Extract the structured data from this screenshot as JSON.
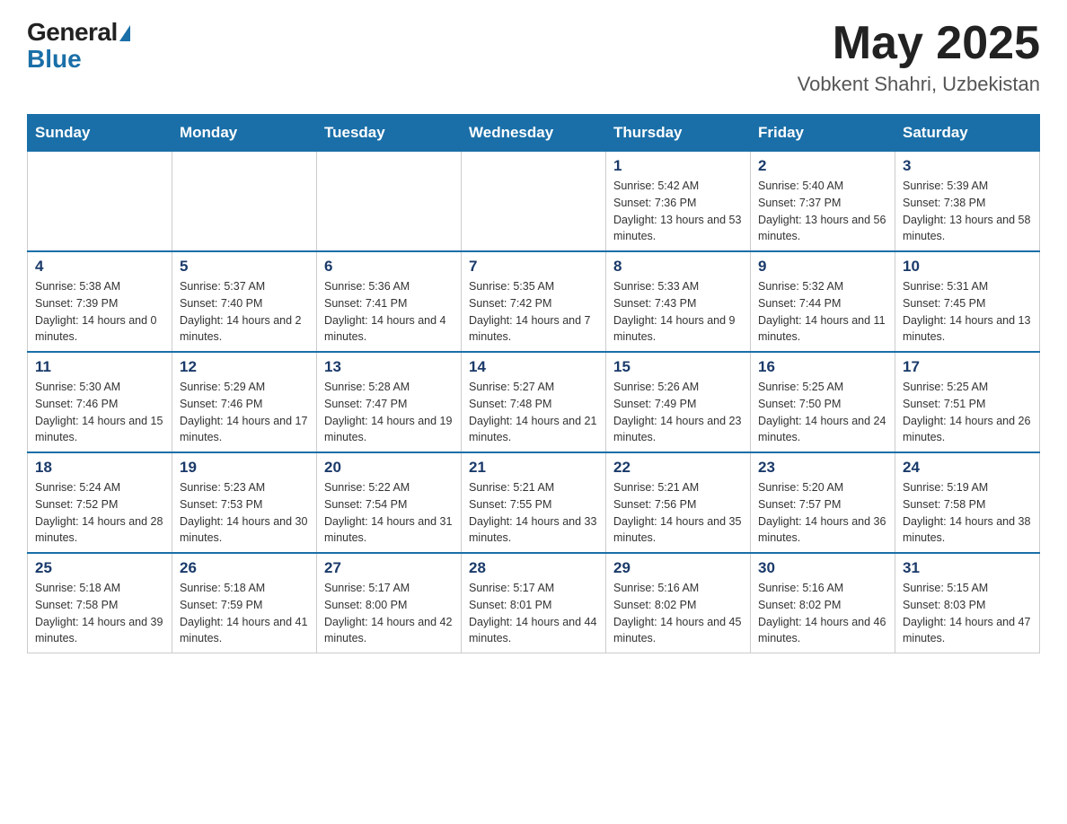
{
  "header": {
    "logo_general": "General",
    "logo_blue": "Blue",
    "month_title": "May 2025",
    "subtitle": "Vobkent Shahri, Uzbekistan"
  },
  "weekdays": [
    "Sunday",
    "Monday",
    "Tuesday",
    "Wednesday",
    "Thursday",
    "Friday",
    "Saturday"
  ],
  "weeks": [
    [
      {
        "day": "",
        "sunrise": "",
        "sunset": "",
        "daylight": ""
      },
      {
        "day": "",
        "sunrise": "",
        "sunset": "",
        "daylight": ""
      },
      {
        "day": "",
        "sunrise": "",
        "sunset": "",
        "daylight": ""
      },
      {
        "day": "",
        "sunrise": "",
        "sunset": "",
        "daylight": ""
      },
      {
        "day": "1",
        "sunrise": "Sunrise: 5:42 AM",
        "sunset": "Sunset: 7:36 PM",
        "daylight": "Daylight: 13 hours and 53 minutes."
      },
      {
        "day": "2",
        "sunrise": "Sunrise: 5:40 AM",
        "sunset": "Sunset: 7:37 PM",
        "daylight": "Daylight: 13 hours and 56 minutes."
      },
      {
        "day": "3",
        "sunrise": "Sunrise: 5:39 AM",
        "sunset": "Sunset: 7:38 PM",
        "daylight": "Daylight: 13 hours and 58 minutes."
      }
    ],
    [
      {
        "day": "4",
        "sunrise": "Sunrise: 5:38 AM",
        "sunset": "Sunset: 7:39 PM",
        "daylight": "Daylight: 14 hours and 0 minutes."
      },
      {
        "day": "5",
        "sunrise": "Sunrise: 5:37 AM",
        "sunset": "Sunset: 7:40 PM",
        "daylight": "Daylight: 14 hours and 2 minutes."
      },
      {
        "day": "6",
        "sunrise": "Sunrise: 5:36 AM",
        "sunset": "Sunset: 7:41 PM",
        "daylight": "Daylight: 14 hours and 4 minutes."
      },
      {
        "day": "7",
        "sunrise": "Sunrise: 5:35 AM",
        "sunset": "Sunset: 7:42 PM",
        "daylight": "Daylight: 14 hours and 7 minutes."
      },
      {
        "day": "8",
        "sunrise": "Sunrise: 5:33 AM",
        "sunset": "Sunset: 7:43 PM",
        "daylight": "Daylight: 14 hours and 9 minutes."
      },
      {
        "day": "9",
        "sunrise": "Sunrise: 5:32 AM",
        "sunset": "Sunset: 7:44 PM",
        "daylight": "Daylight: 14 hours and 11 minutes."
      },
      {
        "day": "10",
        "sunrise": "Sunrise: 5:31 AM",
        "sunset": "Sunset: 7:45 PM",
        "daylight": "Daylight: 14 hours and 13 minutes."
      }
    ],
    [
      {
        "day": "11",
        "sunrise": "Sunrise: 5:30 AM",
        "sunset": "Sunset: 7:46 PM",
        "daylight": "Daylight: 14 hours and 15 minutes."
      },
      {
        "day": "12",
        "sunrise": "Sunrise: 5:29 AM",
        "sunset": "Sunset: 7:46 PM",
        "daylight": "Daylight: 14 hours and 17 minutes."
      },
      {
        "day": "13",
        "sunrise": "Sunrise: 5:28 AM",
        "sunset": "Sunset: 7:47 PM",
        "daylight": "Daylight: 14 hours and 19 minutes."
      },
      {
        "day": "14",
        "sunrise": "Sunrise: 5:27 AM",
        "sunset": "Sunset: 7:48 PM",
        "daylight": "Daylight: 14 hours and 21 minutes."
      },
      {
        "day": "15",
        "sunrise": "Sunrise: 5:26 AM",
        "sunset": "Sunset: 7:49 PM",
        "daylight": "Daylight: 14 hours and 23 minutes."
      },
      {
        "day": "16",
        "sunrise": "Sunrise: 5:25 AM",
        "sunset": "Sunset: 7:50 PM",
        "daylight": "Daylight: 14 hours and 24 minutes."
      },
      {
        "day": "17",
        "sunrise": "Sunrise: 5:25 AM",
        "sunset": "Sunset: 7:51 PM",
        "daylight": "Daylight: 14 hours and 26 minutes."
      }
    ],
    [
      {
        "day": "18",
        "sunrise": "Sunrise: 5:24 AM",
        "sunset": "Sunset: 7:52 PM",
        "daylight": "Daylight: 14 hours and 28 minutes."
      },
      {
        "day": "19",
        "sunrise": "Sunrise: 5:23 AM",
        "sunset": "Sunset: 7:53 PM",
        "daylight": "Daylight: 14 hours and 30 minutes."
      },
      {
        "day": "20",
        "sunrise": "Sunrise: 5:22 AM",
        "sunset": "Sunset: 7:54 PM",
        "daylight": "Daylight: 14 hours and 31 minutes."
      },
      {
        "day": "21",
        "sunrise": "Sunrise: 5:21 AM",
        "sunset": "Sunset: 7:55 PM",
        "daylight": "Daylight: 14 hours and 33 minutes."
      },
      {
        "day": "22",
        "sunrise": "Sunrise: 5:21 AM",
        "sunset": "Sunset: 7:56 PM",
        "daylight": "Daylight: 14 hours and 35 minutes."
      },
      {
        "day": "23",
        "sunrise": "Sunrise: 5:20 AM",
        "sunset": "Sunset: 7:57 PM",
        "daylight": "Daylight: 14 hours and 36 minutes."
      },
      {
        "day": "24",
        "sunrise": "Sunrise: 5:19 AM",
        "sunset": "Sunset: 7:58 PM",
        "daylight": "Daylight: 14 hours and 38 minutes."
      }
    ],
    [
      {
        "day": "25",
        "sunrise": "Sunrise: 5:18 AM",
        "sunset": "Sunset: 7:58 PM",
        "daylight": "Daylight: 14 hours and 39 minutes."
      },
      {
        "day": "26",
        "sunrise": "Sunrise: 5:18 AM",
        "sunset": "Sunset: 7:59 PM",
        "daylight": "Daylight: 14 hours and 41 minutes."
      },
      {
        "day": "27",
        "sunrise": "Sunrise: 5:17 AM",
        "sunset": "Sunset: 8:00 PM",
        "daylight": "Daylight: 14 hours and 42 minutes."
      },
      {
        "day": "28",
        "sunrise": "Sunrise: 5:17 AM",
        "sunset": "Sunset: 8:01 PM",
        "daylight": "Daylight: 14 hours and 44 minutes."
      },
      {
        "day": "29",
        "sunrise": "Sunrise: 5:16 AM",
        "sunset": "Sunset: 8:02 PM",
        "daylight": "Daylight: 14 hours and 45 minutes."
      },
      {
        "day": "30",
        "sunrise": "Sunrise: 5:16 AM",
        "sunset": "Sunset: 8:02 PM",
        "daylight": "Daylight: 14 hours and 46 minutes."
      },
      {
        "day": "31",
        "sunrise": "Sunrise: 5:15 AM",
        "sunset": "Sunset: 8:03 PM",
        "daylight": "Daylight: 14 hours and 47 minutes."
      }
    ]
  ]
}
